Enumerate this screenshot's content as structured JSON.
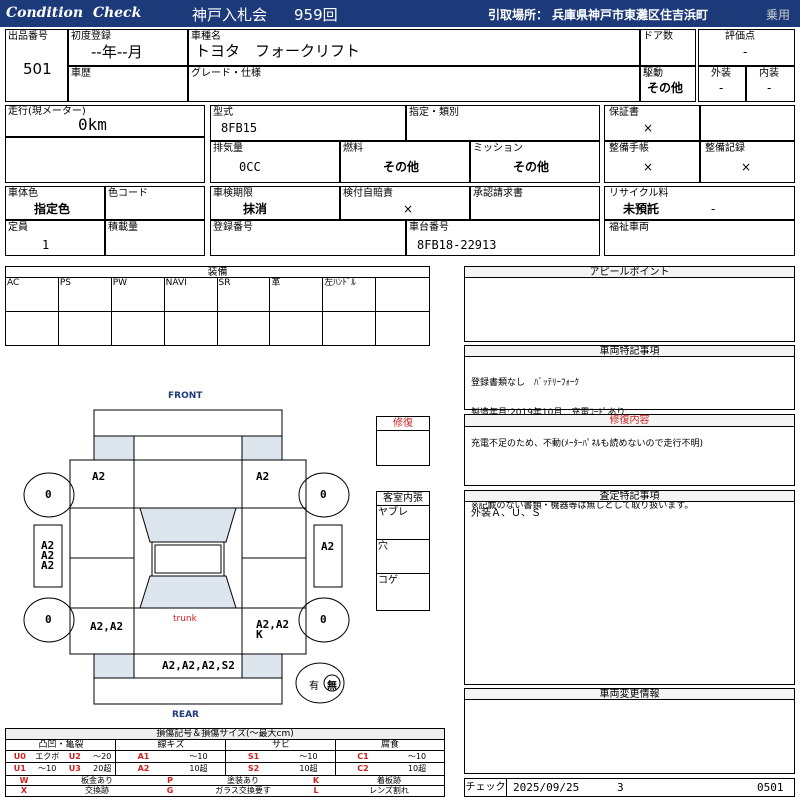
{
  "header": {
    "condition_check": "Condition  Check",
    "auction": "神戸入札会",
    "lot_count": "959回",
    "pickup_label": "引取場所：",
    "pickup_place": "兵庫県神戸市東灘区住吉浜町",
    "category": "乗用"
  },
  "basic": {
    "lot_no_label": "出品番号",
    "lot_no": "501",
    "first_reg_label": "初度登録",
    "first_reg": "--年--月",
    "model_name_label": "車種名",
    "model_name": "トヨタ　フォークリフト",
    "doors_label": "ドア数",
    "score_label": "評価点",
    "score": "-",
    "history_label": "車歴",
    "grade_label": "グレード・仕様",
    "drive_label": "駆動",
    "drive": "その他",
    "exterior_label": "外装",
    "exterior": "-",
    "interior_label": "内装",
    "interior": "-"
  },
  "spec": {
    "mileage_label": "走行(現メーター)",
    "mileage": "0km",
    "type_label": "型式",
    "type": "8FB15",
    "designation_label": "指定・類別",
    "warranty_label": "保証書",
    "warranty": "×",
    "displacement_label": "排気量",
    "displacement": "0CC",
    "fuel_label": "燃料",
    "fuel": "その他",
    "mission_label": "ミッション",
    "mission": "その他",
    "maintenance_label": "整備手帳",
    "maintenance": "×",
    "maint_record_label": "整備記録",
    "maint_record": "×",
    "body_color_label": "車体色",
    "body_color": "指定色",
    "color_code_label": "色コード",
    "inspection_label": "車検期限",
    "inspection": "抹消",
    "cert_label": "検付自賠責",
    "cert": "×",
    "approval_label": "承認請求書",
    "recycle_label": "リサイクル料",
    "recycle": "未預託",
    "recycle_dash": "-",
    "capacity_label": "定員",
    "capacity": "1",
    "load_label": "積載量",
    "reg_no_label": "登録番号",
    "chassis_label": "車台番号",
    "chassis": "8FB18-22913",
    "welfare_label": "福祉車両"
  },
  "equipment": {
    "title": "装備",
    "items": [
      "AC",
      "PS",
      "PW",
      "NAVI",
      "SR",
      "革",
      "左ﾊﾝﾄﾞﾙ",
      ""
    ]
  },
  "diagram": {
    "front": "FRONT",
    "rear": "REAR",
    "trunk": "trunk",
    "marks": {
      "front_left": "A2",
      "front_right": "A2",
      "left_panel": "A2\nA2\nA2",
      "right_panel": "A2",
      "rear_left": "A2,A2",
      "rear_right": "A2,A2\nK",
      "rear_bumper": "A2,A2,A2,S2",
      "tire_fl": "0",
      "tire_fr": "0",
      "tire_rl": "0",
      "tire_rr": "0"
    },
    "spare_label": "有",
    "spare_none": "無"
  },
  "repair": {
    "title": "修復"
  },
  "cabin": {
    "title": "客室内張",
    "items": [
      "ヤブレ",
      "穴",
      "コゲ"
    ]
  },
  "appeal": {
    "title": "アピールポイント"
  },
  "special_notes": {
    "title": "車両特記事項",
    "lines": [
      "登録書類なし　ﾊﾞｯﾃﾘｰﾌｫｰｸ",
      "製造年月:2019年10月　充電ｺｰﾄﾞあり",
      "充電不足のため、不動(ﾒｰﾀｰﾊﾟﾈﾙも読めないので走行不明)",
      "",
      "※記載のない書類・機器等は無しとして取り扱います。"
    ]
  },
  "repair_details": {
    "title": "修復内容"
  },
  "appraisal": {
    "title": "査定特記事項",
    "text": "外装Ａ、Ｕ、Ｓ"
  },
  "changes": {
    "title": "車両変更情報"
  },
  "legend": {
    "title": "損傷記号＆損傷サイズ(〜最大cm)",
    "groups": [
      {
        "name": "凸凹・亀裂",
        "cells": [
          [
            "U0",
            "エクボ",
            "U2",
            "〜20"
          ],
          [
            "U1",
            "〜10",
            "U3",
            "20超"
          ]
        ]
      },
      {
        "name": "線キズ",
        "cells": [
          [
            "A1",
            "〜10"
          ],
          [
            "A2",
            "10超"
          ]
        ]
      },
      {
        "name": "サビ",
        "cells": [
          [
            "S1",
            "〜10"
          ],
          [
            "S2",
            "10超"
          ]
        ]
      },
      {
        "name": "腐食",
        "cells": [
          [
            "C1",
            "〜10"
          ],
          [
            "C2",
            "10超"
          ]
        ]
      }
    ],
    "symbols": [
      [
        "W",
        "板金あり",
        "P",
        "塗装あり",
        "K",
        "着板跡"
      ],
      [
        "X",
        "交換跡",
        "G",
        "ガラス交換要す",
        "L",
        "レンズ割れ"
      ]
    ]
  },
  "check": {
    "label": "チェック",
    "date": "2025/09/25",
    "count": "3",
    "code": "0501"
  }
}
